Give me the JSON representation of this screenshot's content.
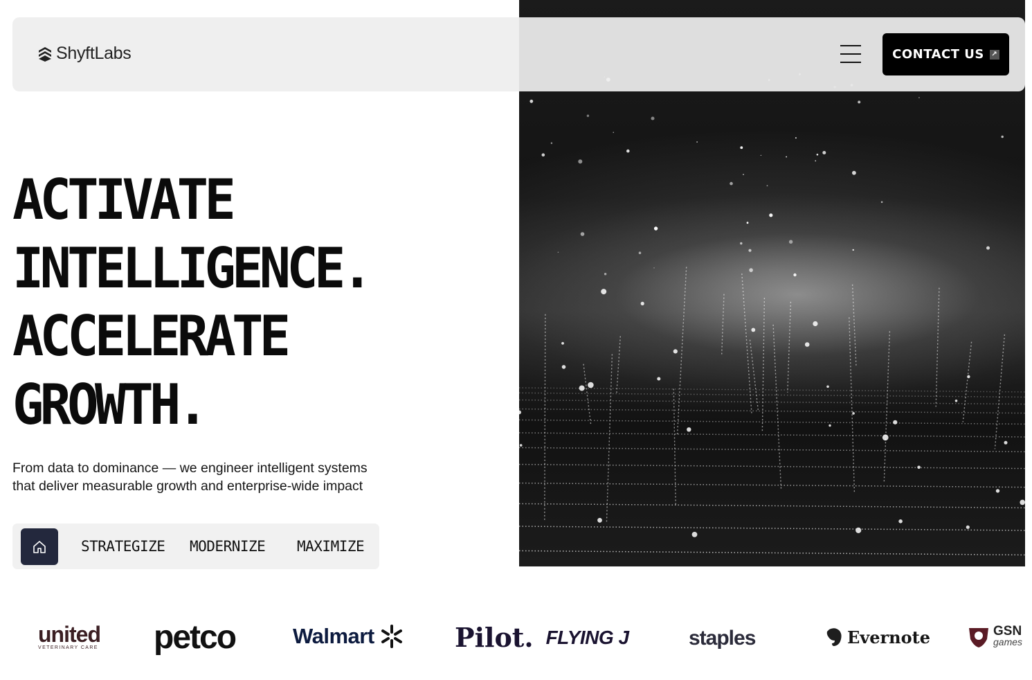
{
  "brand": {
    "name": "ShyftLabs"
  },
  "nav": {
    "menu_icon": "hamburger-menu-icon",
    "contact_label": "CONTACT US",
    "contact_icon": "arrow-up-right-icon"
  },
  "hero": {
    "headline_lines": [
      "ACTIVATE",
      "INTELLIGENCE.",
      "ACCELERATE",
      "GROWTH."
    ],
    "subtext_lines": [
      "From data to dominance — we engineer intelligent systems",
      "that deliver measurable growth and enterprise-wide impact"
    ],
    "tabs": {
      "home_icon": "home-icon",
      "items": [
        "STRATEGIZE",
        "MODERNIZE",
        "MAXIMIZE"
      ]
    }
  },
  "clients": {
    "united": {
      "name": "united",
      "sub": "VETERINARY CARE"
    },
    "petco": "petco",
    "walmart": "Walmart",
    "pilot": "Pilot.",
    "flyingj": "FLYING J",
    "staples": "staples",
    "evernote": "Evernote",
    "gsn": {
      "name": "GSN",
      "sub": "games"
    }
  },
  "colors": {
    "accent_dark": "#23283d",
    "button_bg": "#000000",
    "navbar_bg": "#eeeeee"
  }
}
